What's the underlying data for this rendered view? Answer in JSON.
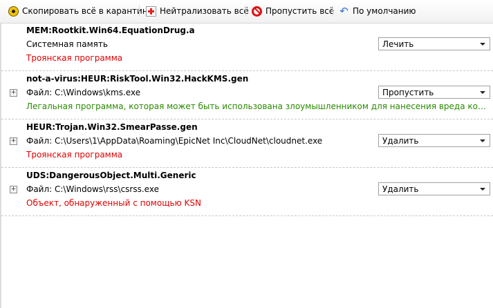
{
  "toolbar": {
    "copy_quarantine": "Скопировать всё в карантин",
    "neutralize_all": "Нейтрализовать всё",
    "skip_all": "Пропустить всё",
    "default": "По умолчанию"
  },
  "threats": [
    {
      "name": "MEM:Rootkit.Win64.EquationDrug.a",
      "path": "Системная память",
      "description": "Троянская программа",
      "action": "Лечить"
    },
    {
      "name": "not-a-virus:HEUR:RiskTool.Win32.HackKMS.gen",
      "path": "Файл: C:\\Windows\\kms.exe",
      "description": "Легальная программа, которая может быть использована злоумышленником для нанесения вреда компьютеру ил...",
      "action": "Пропустить"
    },
    {
      "name": "HEUR:Trojan.Win32.SmearPasse.gen",
      "path": "Файл: C:\\Users\\1\\AppData\\Roaming\\EpicNet Inc\\CloudNet\\cloudnet.exe",
      "description": "Троянская программа",
      "action": "Удалить"
    },
    {
      "name": "UDS:DangerousObject.Multi.Generic",
      "path": "Файл: C:\\Windows\\rss\\csrss.exe",
      "description": "Объект, обнаруженный с помощью KSN",
      "action": "Удалить"
    }
  ],
  "icons": {
    "copy_quarantine": "radiation-icon",
    "neutralize_all": "neutralize-plus-icon",
    "skip_all": "prohibit-icon",
    "default": "undo-arrow-icon",
    "expand": "plus-expander-icon",
    "dropdown": "chevron-down-icon"
  },
  "colors": {
    "danger_text": "#e00000",
    "legal_text": "#2a8a00"
  }
}
